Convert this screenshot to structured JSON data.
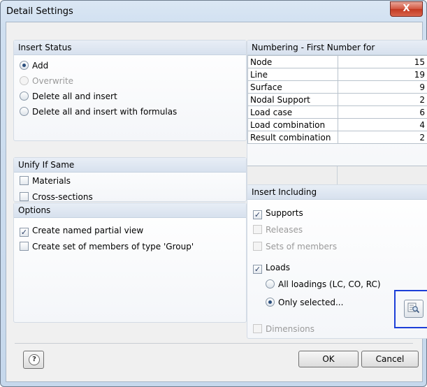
{
  "window": {
    "title": "Detail Settings",
    "close_glyph": "X"
  },
  "insert_status": {
    "header": "Insert Status",
    "options": [
      {
        "label": "Add",
        "checked": true,
        "enabled": true
      },
      {
        "label": "Overwrite",
        "checked": false,
        "enabled": false
      },
      {
        "label": "Delete all and insert",
        "checked": false,
        "enabled": true
      },
      {
        "label": "Delete all and insert with formulas",
        "checked": false,
        "enabled": true
      }
    ]
  },
  "unify": {
    "header": "Unify If Same",
    "items": [
      {
        "label": "Materials",
        "checked": false
      },
      {
        "label": "Cross-sections",
        "checked": false
      }
    ]
  },
  "options": {
    "header": "Options",
    "items": [
      {
        "label": "Create named partial view",
        "checked": true
      },
      {
        "label": "Create set of members of type 'Group'",
        "checked": false
      }
    ]
  },
  "numbering": {
    "header": "Numbering - First Number for",
    "rows": [
      {
        "label": "Node",
        "value": "15"
      },
      {
        "label": "Line",
        "value": "19"
      },
      {
        "label": "Surface",
        "value": "9"
      },
      {
        "label": "Nodal Support",
        "value": "2"
      },
      {
        "label": "Load case",
        "value": "6"
      },
      {
        "label": "Load combination",
        "value": "4"
      },
      {
        "label": "Result combination",
        "value": "2"
      }
    ]
  },
  "insert_including": {
    "header": "Insert Including",
    "supports": {
      "label": "Supports",
      "checked": true,
      "enabled": true
    },
    "releases": {
      "label": "Releases",
      "checked": false,
      "enabled": false
    },
    "sets": {
      "label": "Sets of members",
      "checked": false,
      "enabled": false
    },
    "loads": {
      "label": "Loads",
      "checked": true,
      "enabled": true
    },
    "all_loadings": {
      "label": "All loadings (LC, CO, RC)",
      "checked": false
    },
    "only_selected": {
      "label": "Only selected...",
      "checked": true
    },
    "dimensions": {
      "label": "Dimensions",
      "checked": false,
      "enabled": false
    }
  },
  "buttons": {
    "help_glyph": "?",
    "ok": "OK",
    "cancel": "Cancel"
  }
}
